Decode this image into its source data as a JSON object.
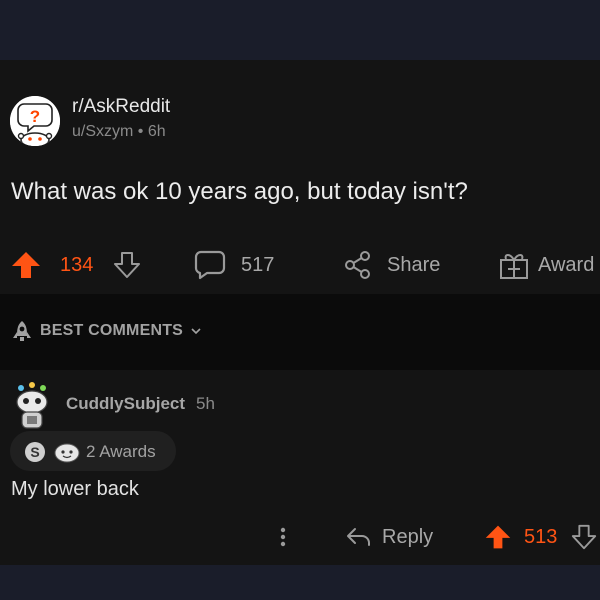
{
  "post": {
    "subreddit": "r/AskReddit",
    "author": "u/Sxzym",
    "meta_separator": "•",
    "age": "6h",
    "title": "What was ok 10 years ago, but today isn't?",
    "upvotes": "134",
    "comments": "517",
    "share_label": "Share",
    "award_label": "Award"
  },
  "sort": {
    "label": "BEST COMMENTS"
  },
  "comment": {
    "username": "CuddlySubject",
    "age": "5h",
    "awards_label": "2 Awards",
    "body": "My lower back",
    "reply_label": "Reply",
    "upvotes": "513"
  },
  "colors": {
    "upvote": "#ff5414",
    "background": "#141414",
    "header_bar": "#1a1d2a"
  }
}
